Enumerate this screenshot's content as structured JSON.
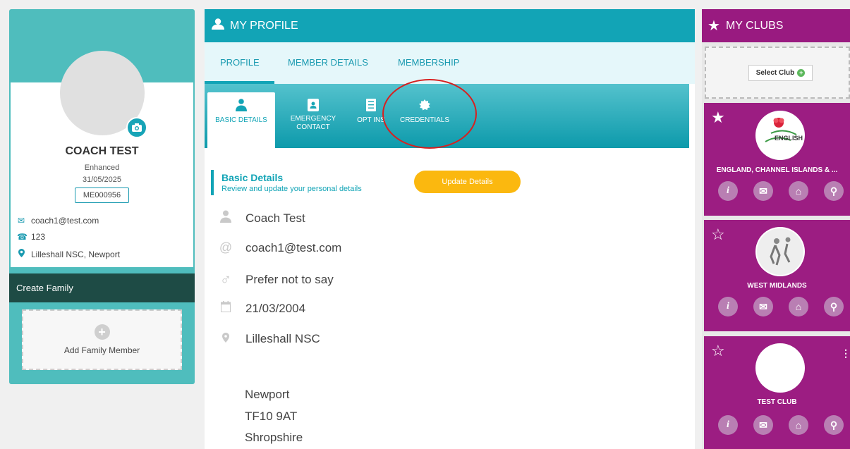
{
  "profile_card": {
    "name": "COACH TEST",
    "status": "Enhanced",
    "expiry": "31/05/2025",
    "member_id": "ME000956",
    "email": "coach1@test.com",
    "phone": "123",
    "location": "Lilleshall NSC, Newport"
  },
  "family": {
    "header": "Create Family",
    "add_label": "Add Family Member"
  },
  "my_profile": {
    "header": "MY PROFILE",
    "tabs": [
      "PROFILE",
      "MEMBER DETAILS",
      "MEMBERSHIP"
    ],
    "sub_tabs": {
      "basic": "BASIC DETAILS",
      "emergency_1": "EMERGENCY",
      "emergency_2": "CONTACT",
      "opt_in": "OPT INS",
      "credentials": "CREDENTIALS"
    },
    "section_title": "Basic Details",
    "section_subtitle": "Review and update your personal details",
    "update_button": "Update Details",
    "details": {
      "name": "Coach Test",
      "email": "coach1@test.com",
      "gender": "Prefer not to say",
      "dob": "21/03/2004",
      "address_line1": "Lilleshall NSC",
      "town": "Newport",
      "postcode": "TF10 9AT",
      "county": "Shropshire"
    }
  },
  "my_clubs": {
    "header": "MY CLUBS",
    "select_club": "Select Club",
    "clubs": [
      {
        "name": "ENGLAND, CHANNEL ISLANDS & ...",
        "favourite": true,
        "logo_text": "ENGLISH"
      },
      {
        "name": "WEST MIDLANDS",
        "favourite": false
      },
      {
        "name": "TEST CLUB",
        "favourite": false
      }
    ]
  },
  "colors": {
    "teal": "#12a4b6",
    "purple": "#9c1d82",
    "amber": "#fbb80f",
    "dark_green": "#1e4b45"
  }
}
